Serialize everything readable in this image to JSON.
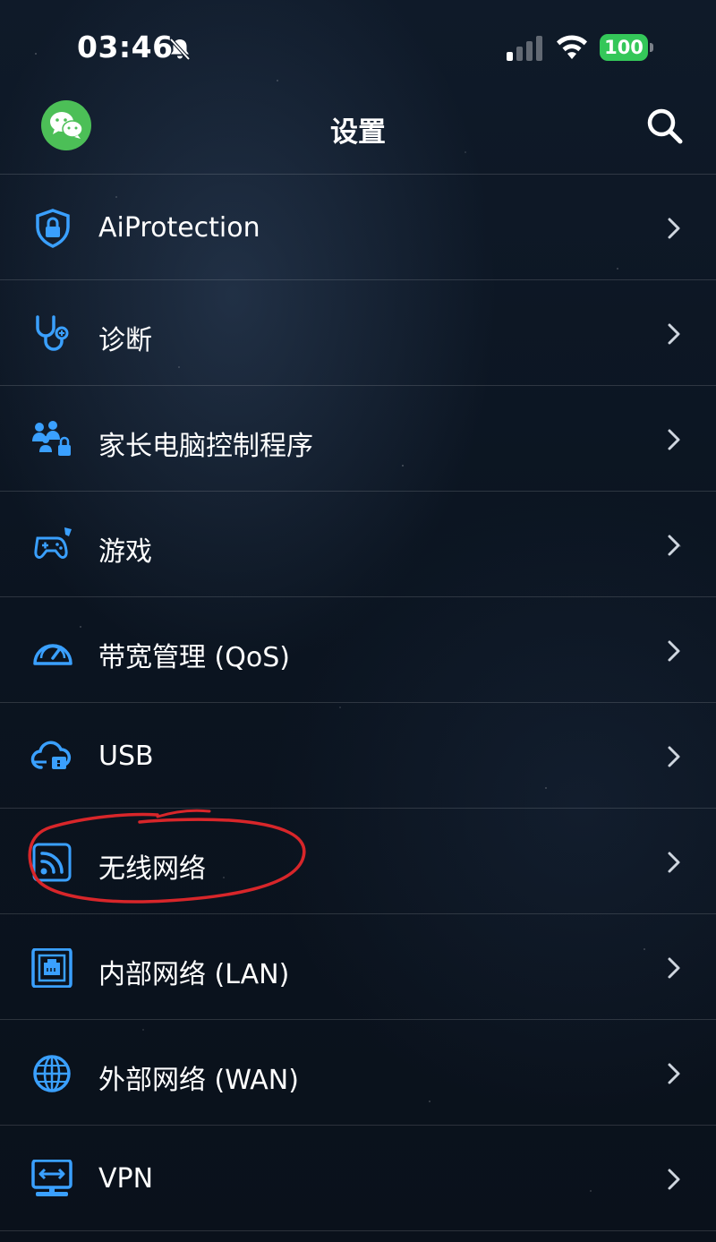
{
  "status_bar": {
    "time": "03:46",
    "battery": "100",
    "icons": [
      "bell-slash-icon",
      "cellular-signal-icon",
      "wifi-icon",
      "battery-icon"
    ]
  },
  "header": {
    "title": "设置",
    "left_icon": "wechat-icon",
    "right_icon": "search-icon"
  },
  "menu": {
    "items": [
      {
        "label": "AiProtection",
        "icon": "shield-lock-icon"
      },
      {
        "label": "诊断",
        "icon": "stethoscope-icon"
      },
      {
        "label": "家长电脑控制程序",
        "icon": "family-lock-icon"
      },
      {
        "label": "游戏",
        "icon": "gamepad-icon"
      },
      {
        "label": "带宽管理 (QoS)",
        "icon": "speedometer-icon"
      },
      {
        "label": "USB",
        "icon": "cloud-usb-icon"
      },
      {
        "label": "无线网络",
        "icon": "wireless-icon",
        "highlighted": true
      },
      {
        "label": "内部网络 (LAN)",
        "icon": "ethernet-port-icon"
      },
      {
        "label": "外部网络 (WAN)",
        "icon": "globe-icon"
      },
      {
        "label": "VPN",
        "icon": "vpn-monitor-icon"
      }
    ]
  },
  "colors": {
    "accent_blue": "#3aa0ff",
    "wechat_green": "#4cbf57",
    "battery_green": "#34c759",
    "annotation_red": "#d8262a",
    "background": "#0b1420"
  }
}
